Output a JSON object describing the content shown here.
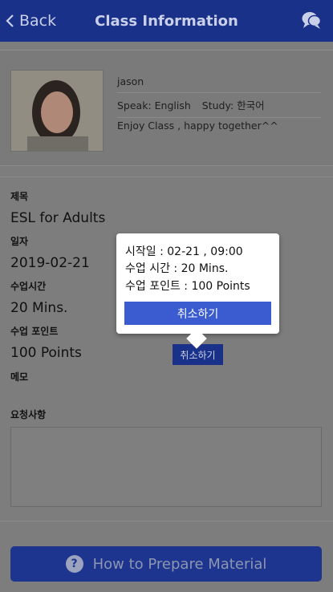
{
  "header": {
    "back_label": "Back",
    "title": "Class Information"
  },
  "profile": {
    "name": "jason",
    "speak_label": "Speak: English",
    "study_label": "Study: 한국어",
    "motto": "Enjoy Class , happy together^^"
  },
  "details": {
    "subject_label": "제목",
    "subject_value": "ESL for Adults",
    "date_label": "일자",
    "date_value": "2019-02-21",
    "duration_label": "수업시간",
    "duration_value": "20 Mins.",
    "points_label": "수업 포인트",
    "points_value": "100 Points",
    "memo_label": "메모",
    "cancel_small_label": "취소하기",
    "request_label": "요청사항"
  },
  "popup": {
    "start_line": "시작일 : 02-21 , 09:00",
    "duration_line": "수업 시간 : 20 Mins.",
    "points_line": "수업 포인트 : 100 Points",
    "cancel_label": "취소하기"
  },
  "footer": {
    "prepare_label": "How to Prepare Material",
    "help_glyph": "?"
  },
  "colors": {
    "header_bg": "#1a3189",
    "popup_button": "#3b5bd0",
    "overlay": "#7d7d7d"
  }
}
